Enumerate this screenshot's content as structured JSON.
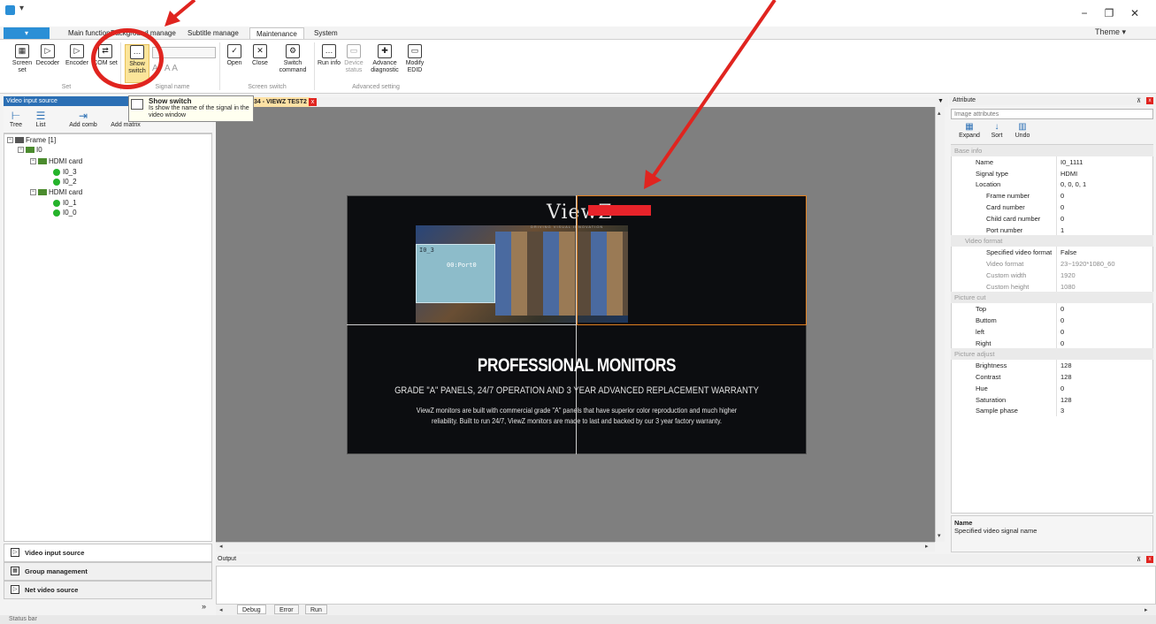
{
  "window": {
    "quick_access": "▾",
    "minimize": "−",
    "restore": "❐",
    "close": "✕"
  },
  "ribbon_tabs": {
    "file": "▾",
    "main_function": "Main function",
    "background": "Background manage",
    "subtitle": "Subtitle manage",
    "maintenance": "Maintenance",
    "system": "System"
  },
  "theme": "Theme ▾",
  "ribbon": {
    "screen_set": "Screen set",
    "decoder": "Decoder",
    "encoder": "Encoder",
    "com_set": "COM set",
    "show_switch": "Show switch",
    "open": "Open",
    "close": "Close",
    "switch_command": "Switch command",
    "run_info": "Run info",
    "device_status": "Device status",
    "advance_diagnostic": "Advance diagnostic",
    "modify_edid": "Modify EDID",
    "groups": {
      "set": "Set",
      "signal_name": "Signal name",
      "screen_switch": "Screen switch",
      "advanced_setting": "Advanced setting"
    }
  },
  "tooltip": {
    "title": "Show switch",
    "text": "Is show the name of the signal in the video window"
  },
  "left_panel": {
    "header": "Video input source",
    "tools": {
      "tree": "Tree",
      "list": "List",
      "add_comb": "Add comb",
      "add_matrix": "Add matrix"
    },
    "tree": {
      "frame": "Frame [1]",
      "io": "I0",
      "card1": "HDMI card",
      "io3": "I0_3",
      "io2": "I0_2",
      "card2": "HDMI card",
      "io1": "I0_1",
      "io0": "I0_0"
    },
    "nav": {
      "video_input": "Video input source",
      "group_mgmt": "Group management",
      "net_video": "Net video source"
    },
    "more": "»"
  },
  "document_tab": {
    "title": "34 - VIEWZ TEST2",
    "close": "x"
  },
  "video": {
    "logo": "ViewZ",
    "tagline": "DRIVING VISUAL INNOVATION",
    "window_label": "I0_3",
    "port_label": "00:Port0",
    "headline": "PROFESSIONAL MONITORS",
    "subhead": "GRADE \"A\" PANELS, 24/7 OPERATION AND 3 YEAR ADVANCED REPLACEMENT WARRANTY",
    "body_line1": "ViewZ monitors are built with commercial grade \"A\" panels that have superior color reproduction and much higher",
    "body_line2": "reliability. Built to run 24/7, ViewZ monitors are made to last and backed by our 3 year factory warranty."
  },
  "output": {
    "title": "Output",
    "tabs": {
      "debug": "Debug",
      "error": "Error",
      "run": "Run"
    }
  },
  "status_bar": "Status bar",
  "attribute_panel": {
    "header": "Attribute",
    "selector": "Image attributes",
    "tools": {
      "expand": "Expand",
      "sort": "Sort",
      "undo": "Undo"
    },
    "rows": [
      {
        "k": "Base info",
        "v": "",
        "type": "cat"
      },
      {
        "k": "Name",
        "v": "I0_1111",
        "type": "row",
        "indent": 1
      },
      {
        "k": "Signal type",
        "v": "HDMI",
        "type": "row",
        "indent": 1
      },
      {
        "k": "Location",
        "v": "0, 0, 0, 1",
        "type": "row",
        "indent": 1,
        "toggle": "⊟"
      },
      {
        "k": "Frame number",
        "v": "0",
        "type": "row",
        "indent": 2
      },
      {
        "k": "Card number",
        "v": "0",
        "type": "row",
        "indent": 2
      },
      {
        "k": "Child card number",
        "v": "0",
        "type": "row",
        "indent": 2
      },
      {
        "k": "Port number",
        "v": "1",
        "type": "row",
        "indent": 2
      },
      {
        "k": "Video format",
        "v": "",
        "type": "cat",
        "indent": 1
      },
      {
        "k": "Specified video format",
        "v": "False",
        "type": "row",
        "indent": 2
      },
      {
        "k": "Video format",
        "v": "23~1920*1080_60",
        "type": "gray",
        "indent": 2
      },
      {
        "k": "Custom width",
        "v": "1920",
        "type": "gray",
        "indent": 2
      },
      {
        "k": "Custom height",
        "v": "1080",
        "type": "gray",
        "indent": 2
      },
      {
        "k": "Picture cut",
        "v": "",
        "type": "cat"
      },
      {
        "k": "Top",
        "v": "0",
        "type": "row",
        "indent": 1
      },
      {
        "k": "Buttom",
        "v": "0",
        "type": "row",
        "indent": 1
      },
      {
        "k": "left",
        "v": "0",
        "type": "row",
        "indent": 1
      },
      {
        "k": "Right",
        "v": "0",
        "type": "row",
        "indent": 1
      },
      {
        "k": "Picture adjust",
        "v": "",
        "type": "cat"
      },
      {
        "k": "Brightness",
        "v": "128",
        "type": "row",
        "indent": 1
      },
      {
        "k": "Contrast",
        "v": "128",
        "type": "row",
        "indent": 1
      },
      {
        "k": "Hue",
        "v": "0",
        "type": "row",
        "indent": 1
      },
      {
        "k": "Saturation",
        "v": "128",
        "type": "row",
        "indent": 1
      },
      {
        "k": "Sample phase",
        "v": "3",
        "type": "row",
        "indent": 1
      }
    ],
    "desc_title": "Name",
    "desc_text": "Specified video signal name"
  },
  "colors": {
    "accent": "#2b8fd6",
    "annotation_red": "#e0241f",
    "highlight": "#fbe59a"
  }
}
